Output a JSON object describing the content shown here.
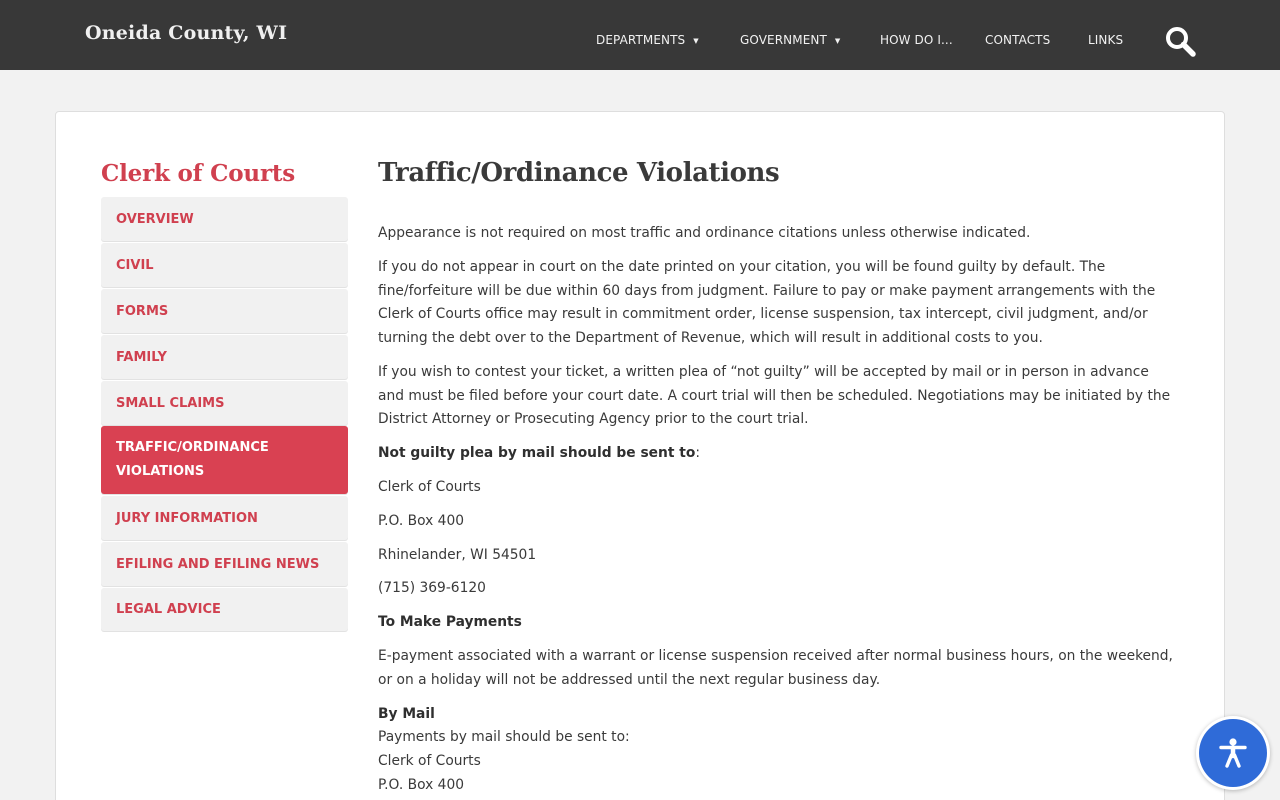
{
  "header": {
    "site_title": "Oneida County, WI",
    "nav": [
      {
        "label": "DEPARTMENTS",
        "caret": "▼"
      },
      {
        "label": "GOVERNMENT",
        "caret": "▼"
      },
      {
        "label": "HOW DO I..."
      },
      {
        "label": "CONTACTS"
      },
      {
        "label": "LINKS"
      }
    ],
    "search_icon": "search-icon"
  },
  "sidebar": {
    "title": "Clerk of Courts",
    "items": [
      {
        "label": "OVERVIEW"
      },
      {
        "label": "CIVIL"
      },
      {
        "label": "FORMS"
      },
      {
        "label": "FAMILY"
      },
      {
        "label": "SMALL CLAIMS"
      },
      {
        "label": "TRAFFIC/ORDINANCE VIOLATIONS",
        "active": true
      },
      {
        "label": "JURY INFORMATION"
      },
      {
        "label": "EFILING AND EFILING NEWS"
      },
      {
        "label": "LEGAL ADVICE"
      }
    ]
  },
  "main": {
    "title": "Traffic/Ordinance Violations",
    "p1": "Appearance is not required on most traffic and ordinance citations unless otherwise indicated.",
    "p2": "If you do not appear in court on the date printed on your citation, you will be found guilty by default. The fine/forfeiture will be due within 60 days from judgment. Failure to pay or make payment arrangements with the Clerk of Courts office may result in commitment order, license suspension, tax intercept, civil judgment, and/or turning the debt over to the Department of Revenue, which will result in additional costs to you.",
    "p3": "If you wish to contest your ticket, a written plea of “not guilty” will be accepted by mail or in person in advance and must be filed before your court date. A court trial will then be scheduled. Negotiations may be initiated by the District Attorney or Prosecuting Agency prior to the court trial.",
    "mail_heading": "Not guilty plea by mail should be sent to",
    "mail_heading_suffix": ":",
    "address_name": "Clerk of Courts",
    "address_box": "P.O. Box 400",
    "address_city": "Rhinelander, WI 54501",
    "phone": "(715) 369-6120",
    "payments_heading": "To Make Payments",
    "payments_text": "E-payment associated with a warrant or license suspension received after normal business hours, on the weekend, or on a holiday will not be addressed until the next regular business day.",
    "by_mail_heading": "By Mail",
    "by_mail_text": "Payments by mail should be sent to:",
    "by_mail_name": "Clerk of Courts",
    "by_mail_box": "P.O. Box 400"
  },
  "accessibility": {
    "icon": "accessibility-icon"
  },
  "colors": {
    "header_bg": "#383838",
    "accent": "#d94152",
    "accessibility_blue": "#2f6bd8"
  }
}
